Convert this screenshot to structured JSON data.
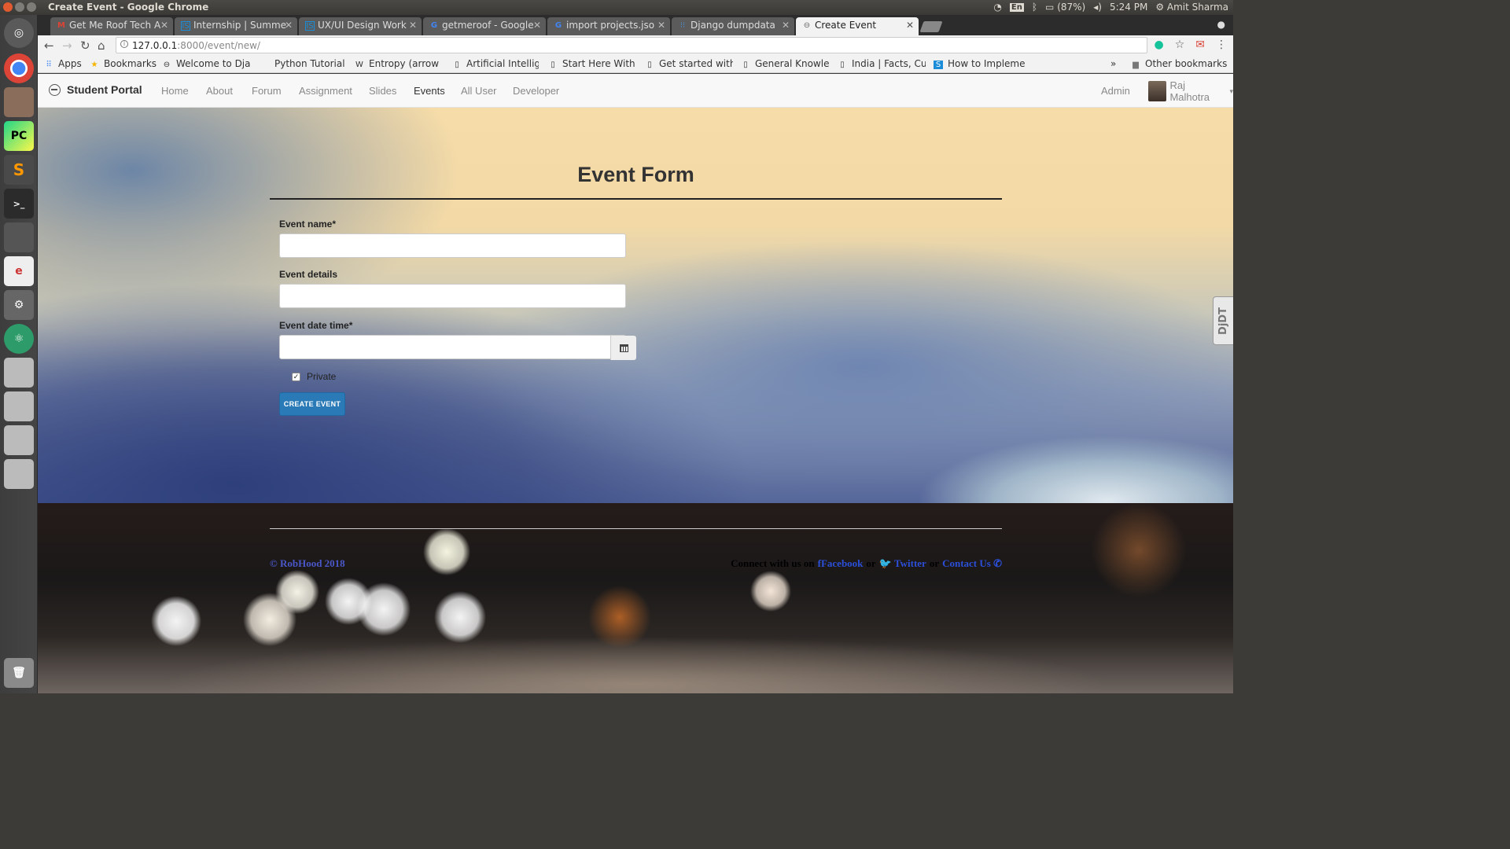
{
  "os": {
    "window_title": "Create Event - Google Chrome",
    "tray": {
      "lang": "En",
      "battery": "(87%)",
      "clock": "5:24 PM",
      "user": "Amit Sharma"
    }
  },
  "browser": {
    "tabs": [
      {
        "label": "Get Me Roof Tech A",
        "icon": "gmail-icon"
      },
      {
        "label": "Internship | Summe",
        "icon": "internshala-icon"
      },
      {
        "label": "UX/UI Design Work",
        "icon": "internshala-icon"
      },
      {
        "label": "getmeroof - Google",
        "icon": "google-icon"
      },
      {
        "label": "import projects.jso",
        "icon": "google-icon"
      },
      {
        "label": "Django dumpdata",
        "icon": "stackoverflow-icon"
      },
      {
        "label": "Create Event",
        "icon": "page-icon",
        "active": true
      }
    ],
    "url_host": "127.0.0.1",
    "url_path": ":8000/event/new/",
    "bookmarks": [
      "Apps",
      "Bookmarks",
      "Welcome to Dja",
      "Python Tutorial:",
      "Entropy (arrow",
      "Artificial Intellig",
      "Start Here With",
      "Get started with",
      "General Knowlec",
      "India | Facts, Cul",
      "How to Impleme"
    ],
    "more_bookmarks": "»",
    "other_bookmarks": "Other bookmarks"
  },
  "navbar": {
    "brand": "Student Portal",
    "links": [
      "Home",
      "About",
      "Forum",
      "Assignment",
      "Slides",
      "Events",
      "All User",
      "Developer"
    ],
    "active_link": "Events",
    "admin": "Admin",
    "user": "Raj Malhotra"
  },
  "form": {
    "title": "Event Form",
    "fields": [
      {
        "label": "Event name*",
        "value": ""
      },
      {
        "label": "Event details",
        "value": ""
      },
      {
        "label": "Event date time*",
        "value": ""
      }
    ],
    "private_label": "Private",
    "private_checked": true,
    "submit_label": "CREATE EVENT"
  },
  "debug_toolbar": "DjDT",
  "footer": {
    "copyright": "© RobHood 2018",
    "connect": "Connect with us on",
    "facebook": "Facebook",
    "or1": "or",
    "twitter": "Twitter",
    "or2": "or",
    "contact": "Contact Us"
  },
  "colors": {
    "accent": "#2a7ab7",
    "footer_link": "#2b4fd8"
  }
}
